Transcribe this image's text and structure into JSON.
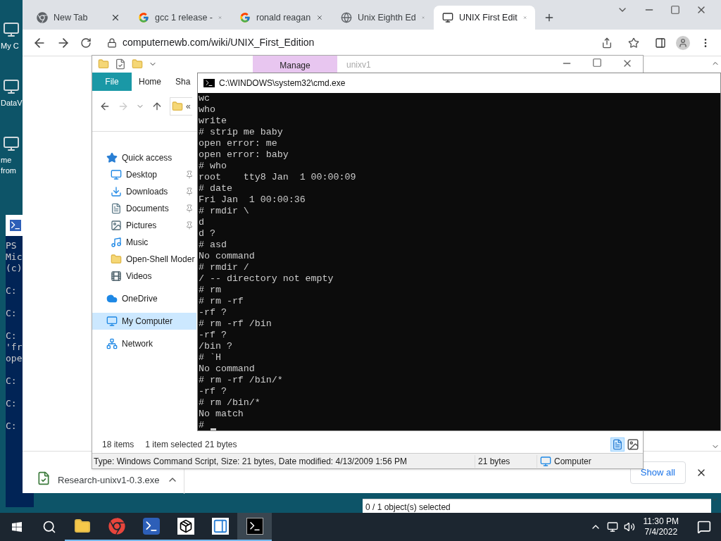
{
  "desktop_icons": [
    {
      "lines": [
        "My C"
      ]
    },
    {
      "lines": [
        "DataV"
      ]
    },
    {
      "lines": [
        "me",
        "from"
      ]
    }
  ],
  "powershell": {
    "blocks": [
      [
        "PS",
        "Mic",
        "(c)"
      ],
      [
        "C:"
      ],
      [
        "C:"
      ],
      [
        "C:",
        "'fr",
        "ope"
      ],
      [
        "C:"
      ],
      [
        "C:"
      ],
      [
        "C:"
      ]
    ]
  },
  "browser": {
    "tabs": [
      {
        "title": "New Tab",
        "kind": "chrome",
        "selected": false
      },
      {
        "title": "gcc 1 release -",
        "kind": "google",
        "selected": false
      },
      {
        "title": "ronald reagan",
        "kind": "google",
        "selected": false
      },
      {
        "title": "Unix Eighth Ed",
        "kind": "globe",
        "selected": false
      },
      {
        "title": "UNIX First Edit",
        "kind": "unix",
        "selected": true
      }
    ],
    "address": "computernewb.com/wiki/UNIX_First_Edition",
    "download": {
      "filename": "Research-unixv1-0.3.exe"
    },
    "show_all": "Show all"
  },
  "explorer": {
    "context_tab": "Manage",
    "title": "unixv1",
    "ribbon_tabs": [
      {
        "label": "File",
        "selected": true
      },
      {
        "label": "Home",
        "selected": false
      },
      {
        "label": "Sha",
        "selected": false
      }
    ],
    "address_chevron": "«",
    "nav": [
      {
        "label": "Quick access",
        "kind": "star",
        "selected": false,
        "children": [
          {
            "label": "Desktop",
            "kind": "desktop",
            "pinned": true,
            "selected": false
          },
          {
            "label": "Downloads",
            "kind": "downloads",
            "pinned": true,
            "selected": false
          },
          {
            "label": "Documents",
            "kind": "documents",
            "pinned": true,
            "selected": false
          },
          {
            "label": "Pictures",
            "kind": "pictures",
            "pinned": true,
            "selected": false
          },
          {
            "label": "Music",
            "kind": "music",
            "pinned": false,
            "selected": false
          },
          {
            "label": "Open-Shell Moder",
            "kind": "folder",
            "pinned": false,
            "selected": false
          },
          {
            "label": "Videos",
            "kind": "videos",
            "pinned": false,
            "selected": false
          }
        ]
      },
      {
        "label": "OneDrive",
        "kind": "cloud",
        "selected": false
      },
      {
        "label": "My Computer",
        "kind": "computer",
        "selected": true
      },
      {
        "label": "Network",
        "kind": "network",
        "selected": false
      }
    ],
    "status": {
      "items": "18 items",
      "selection": "1 item selected",
      "size": "21 bytes"
    },
    "details": {
      "description": "Type: Windows Command Script, Size: 21 bytes, Date modified: 4/13/2009 1:56 PM",
      "size": "21 bytes",
      "location": "Computer"
    }
  },
  "cmd": {
    "title": "C:\\WINDOWS\\system32\\cmd.exe",
    "lines": [
      "wc",
      "who",
      "write",
      "# strip me baby",
      "open error: me",
      "open error: baby",
      "# who",
      "root    tty8 Jan  1 00:00:09",
      "# date",
      "Fri Jan  1 00:00:36",
      "# rmdir \\",
      "d",
      "d ?",
      "# asd",
      "No command",
      "# rmdir /",
      "/ -- directory not empty",
      "# rm",
      "# rm -rf",
      "-rf ?",
      "# rm -rf /bin",
      "-rf ?",
      "/bin ?",
      "# `H",
      "No command",
      "# rm -rf /bin/*",
      "-rf ?",
      "# rm /bin/*",
      "No match",
      "#"
    ]
  },
  "background_window": {
    "status": "0 / 1 object(s) selected"
  },
  "taskbar": {
    "apps": [
      {
        "kind": "folder",
        "running": true,
        "active": false
      },
      {
        "kind": "chrome",
        "running": true,
        "active": false
      },
      {
        "kind": "powershell",
        "running": true,
        "active": false
      },
      {
        "kind": "sevenzip",
        "running": true,
        "active": false
      },
      {
        "kind": "window",
        "running": true,
        "active": false
      },
      {
        "kind": "cmd",
        "running": true,
        "active": true
      }
    ],
    "time": "11:30 PM",
    "date": "7/4/2022"
  }
}
